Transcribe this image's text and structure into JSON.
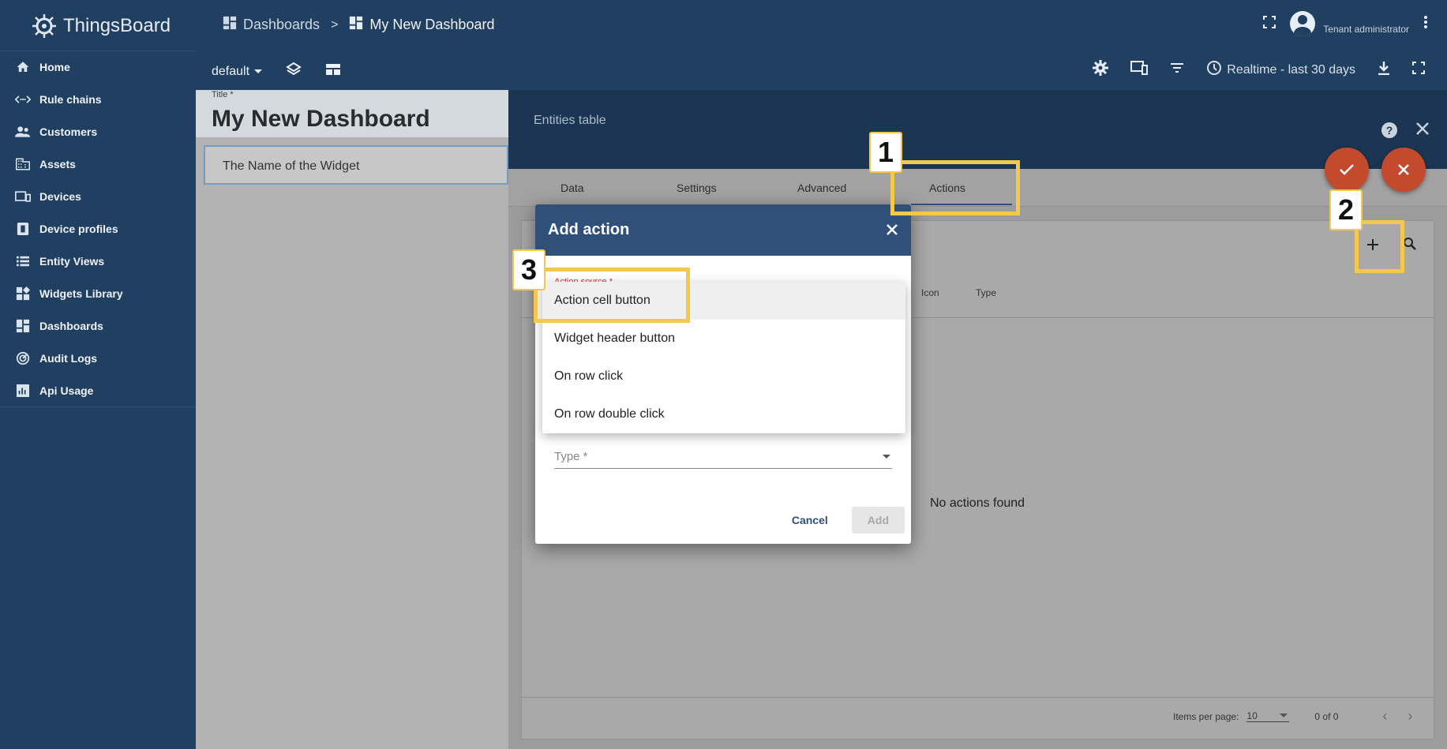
{
  "app": {
    "name": "ThingsBoard"
  },
  "sidebar": {
    "items": [
      {
        "label": "Home",
        "icon": "home-icon"
      },
      {
        "label": "Rule chains",
        "icon": "rule-chain-icon"
      },
      {
        "label": "Customers",
        "icon": "customers-icon"
      },
      {
        "label": "Assets",
        "icon": "assets-icon"
      },
      {
        "label": "Devices",
        "icon": "devices-icon"
      },
      {
        "label": "Device profiles",
        "icon": "device-profile-icon"
      },
      {
        "label": "Entity Views",
        "icon": "entity-views-icon"
      },
      {
        "label": "Widgets Library",
        "icon": "widgets-icon"
      },
      {
        "label": "Dashboards",
        "icon": "dashboards-icon"
      },
      {
        "label": "Audit Logs",
        "icon": "audit-logs-icon"
      },
      {
        "label": "Api Usage",
        "icon": "api-usage-icon"
      }
    ]
  },
  "header": {
    "breadcrumb_root": "Dashboards",
    "breadcrumb_sep": ">",
    "breadcrumb_current": "My New Dashboard",
    "user_role": "Tenant administrator"
  },
  "toolbar": {
    "state_select": "default",
    "timewindow": "Realtime - last 30 days"
  },
  "dashboard": {
    "title_label": "Title *",
    "title": "My New Dashboard",
    "widget_title": "The Name of the Widget"
  },
  "editor": {
    "title": "Entities table",
    "tabs": [
      "Data",
      "Settings",
      "Advanced",
      "Actions"
    ],
    "active_tab": "Actions",
    "columns": [
      "Icon",
      "Type"
    ],
    "empty_text": "No actions found",
    "pager": {
      "label": "Items per page:",
      "size": "10",
      "range": "0 of 0"
    }
  },
  "dialog": {
    "title": "Add action",
    "action_source_label": "Action source *",
    "options": [
      "Action cell button",
      "Widget header button",
      "On row click",
      "On row double click"
    ],
    "highlighted_option": "Action cell button",
    "type_placeholder": "Type *",
    "cancel": "Cancel",
    "add": "Add"
  },
  "callouts": [
    "1",
    "2",
    "3"
  ],
  "colors": {
    "primary": "#30507a",
    "sidebar": "#213f60",
    "fab": "#c34a2c",
    "highlight": "#f5c74a",
    "error": "#d0302a"
  }
}
